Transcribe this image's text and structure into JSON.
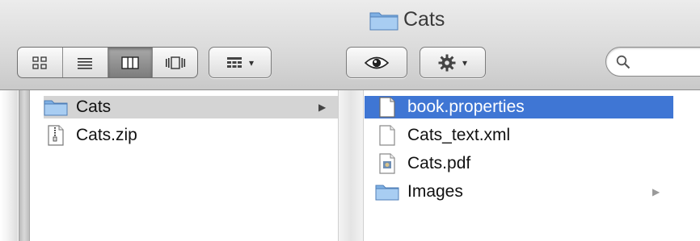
{
  "window": {
    "title": "Cats",
    "title_icon": "folder-icon"
  },
  "toolbar": {
    "view_modes": [
      {
        "name": "icon-view",
        "icon": "grid-icon",
        "active": false
      },
      {
        "name": "list-view",
        "icon": "list-icon",
        "active": false
      },
      {
        "name": "column-view",
        "icon": "columns-icon",
        "active": true
      },
      {
        "name": "cover-flow-view",
        "icon": "coverflow-icon",
        "active": false
      }
    ],
    "arrange_button": {
      "icon": "arrange-icon",
      "chevron": "▾"
    },
    "quick_look_button": {
      "icon": "eye-icon"
    },
    "action_button": {
      "icon": "gear-icon",
      "chevron": "▾"
    },
    "search": {
      "placeholder": "",
      "value": "",
      "icon": "search-icon"
    }
  },
  "columns": [
    {
      "items": [
        {
          "name": "Cats",
          "icon": "folder-icon",
          "selected": "inactive",
          "has_children": true
        },
        {
          "name": "Cats.zip",
          "icon": "zip-icon",
          "selected": "none",
          "has_children": false
        }
      ]
    },
    {
      "items": [
        {
          "name": "book.properties",
          "icon": "document-icon",
          "selected": "active",
          "has_children": false
        },
        {
          "name": "Cats_text.xml",
          "icon": "document-icon",
          "selected": "none",
          "has_children": false
        },
        {
          "name": "Cats.pdf",
          "icon": "pdf-icon",
          "selected": "none",
          "has_children": false
        },
        {
          "name": "Images",
          "icon": "folder-icon",
          "selected": "none",
          "has_children": true
        }
      ]
    }
  ],
  "colors": {
    "selection_active": "#3f76d4",
    "selection_inactive": "#d4d4d4",
    "folder_blue": "#8fb9e6"
  }
}
